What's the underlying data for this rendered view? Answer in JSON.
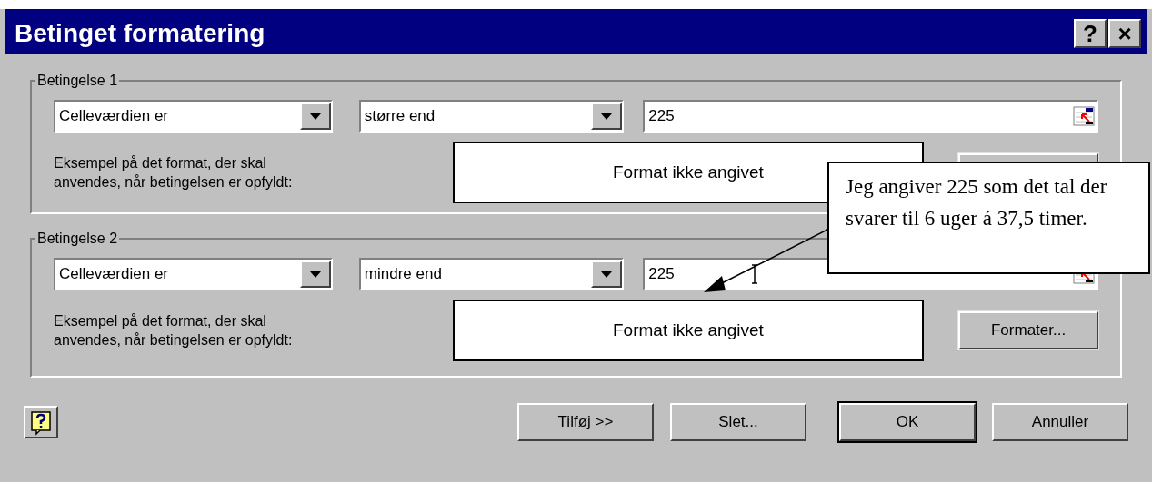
{
  "window": {
    "title": "Betinget formatering",
    "title_buttons": [
      "?",
      "×"
    ]
  },
  "conditions": [
    {
      "label": "Betingelse 1",
      "operand_type": "Celleværdien er",
      "operator": "større end",
      "value": "225",
      "example_label": "Eksempel på det format, der skal anvendes, når betingelsen er opfyldt:",
      "preview": "Format ikke angivet"
    },
    {
      "label": "Betingelse 2",
      "operand_type": "Celleværdien er",
      "operator": "mindre end",
      "value": "225",
      "example_label": "Eksempel på det format, der skal anvendes, når betingelsen er opfyldt:",
      "preview": "Format ikke angivet",
      "format_button": "Formater..."
    }
  ],
  "buttons": [
    {
      "label": "Tilføj >>",
      "default": false
    },
    {
      "label": "Slet...",
      "default": false
    },
    {
      "label": "OK",
      "default": true
    },
    {
      "label": "Annuller",
      "default": false
    }
  ],
  "callout": {
    "text": "Jeg angiver 225 som det tal der svarer til 6 uger á 37,5 timer."
  }
}
